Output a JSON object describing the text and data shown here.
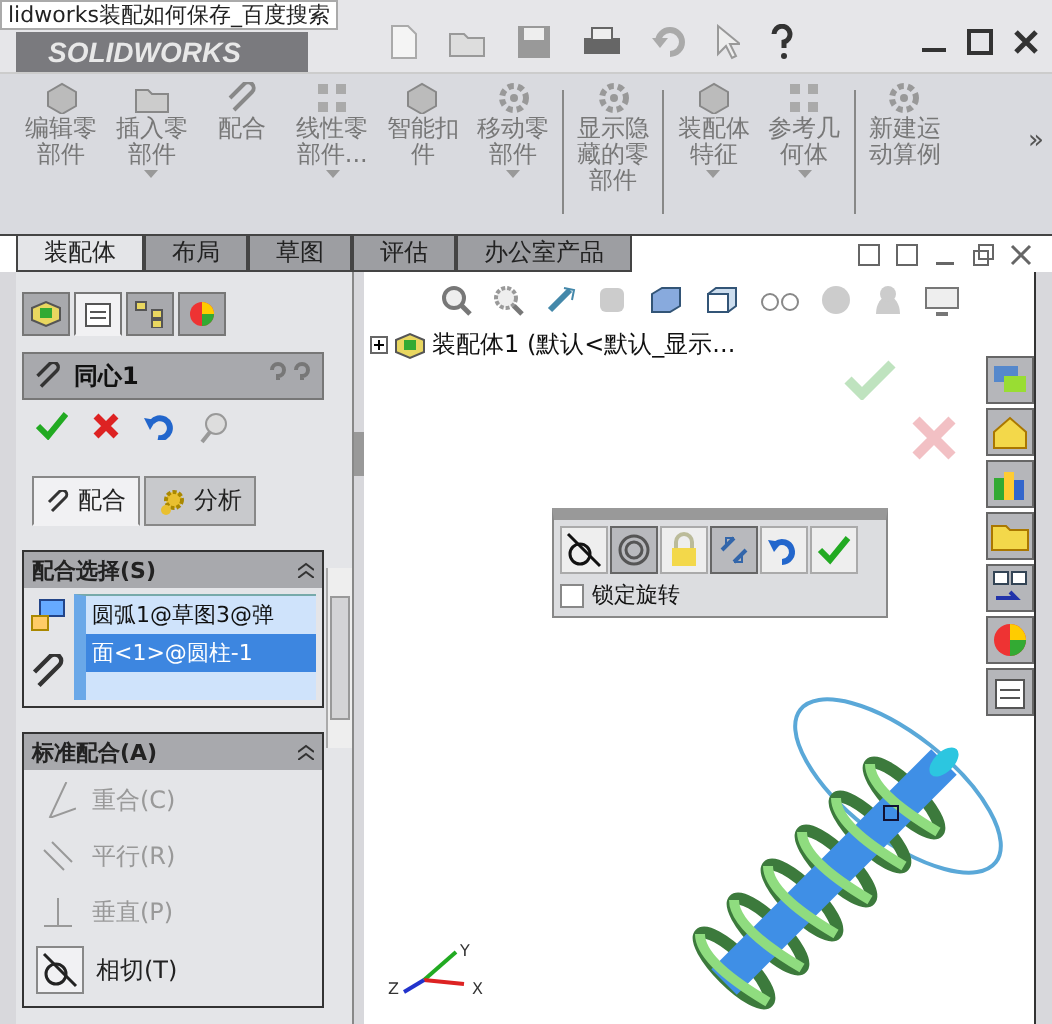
{
  "tooltip": "lidworks装配如何保存_百度搜索",
  "app_logo": "SOLIDWORKS",
  "ribbon": {
    "groups": [
      [
        {
          "label": "编辑零部件",
          "kind": "cube",
          "dropdown": false
        },
        {
          "label": "插入零部件",
          "kind": "folder",
          "dropdown": true
        },
        {
          "label": "配合",
          "kind": "paperclip",
          "dropdown": false
        },
        {
          "label": "线性零部件...",
          "kind": "grid",
          "dropdown": true
        },
        {
          "label": "智能扣件",
          "kind": "cube",
          "dropdown": false
        },
        {
          "label": "移动零部件",
          "kind": "gear",
          "dropdown": true
        }
      ],
      [
        {
          "label": "显示隐藏的零部件",
          "kind": "gear",
          "dropdown": false
        }
      ],
      [
        {
          "label": "装配体特征",
          "kind": "cube",
          "dropdown": true
        },
        {
          "label": "参考几何体",
          "kind": "grid",
          "dropdown": true
        }
      ],
      [
        {
          "label": "新建运动算例",
          "kind": "gear",
          "dropdown": false
        }
      ]
    ],
    "more": "»"
  },
  "tabs": [
    {
      "label": "装配体",
      "selected": true
    },
    {
      "label": "布局",
      "selected": false
    },
    {
      "label": "草图",
      "selected": false
    },
    {
      "label": "评估",
      "selected": false
    },
    {
      "label": "办公室产品",
      "selected": false
    }
  ],
  "panel_tabs": [
    {
      "kind": "feature",
      "selected": false
    },
    {
      "kind": "property",
      "selected": true
    },
    {
      "kind": "config",
      "selected": false
    },
    {
      "kind": "display",
      "selected": false
    }
  ],
  "property_title": "同心1",
  "subtabs": [
    {
      "label": "配合",
      "selected": true
    },
    {
      "label": "分析",
      "selected": false
    }
  ],
  "mate_selections": {
    "title": "配合选择(S)",
    "items": [
      {
        "text": "圆弧1@草图3@弹",
        "selected": false
      },
      {
        "text": "面<1>@圆柱-1",
        "selected": true
      }
    ]
  },
  "standard_mates": {
    "title": "标准配合(A)",
    "items": [
      {
        "label": "重合(C)",
        "kind": "coincident",
        "enabled": false
      },
      {
        "label": "平行(R)",
        "kind": "parallel",
        "enabled": false
      },
      {
        "label": "垂直(P)",
        "kind": "perpendicular",
        "enabled": false
      },
      {
        "label": "相切(T)",
        "kind": "tangent",
        "enabled": true
      }
    ]
  },
  "tree_root": {
    "label": "装配体1  (默认<默认_显示...",
    "expanded": false
  },
  "mate_popup": {
    "buttons": [
      {
        "kind": "tangent",
        "selected": false
      },
      {
        "kind": "concentric",
        "selected": true
      },
      {
        "kind": "lock",
        "selected": false
      },
      {
        "kind": "flip",
        "selected": true
      },
      {
        "kind": "undo",
        "selected": false
      },
      {
        "kind": "ok",
        "selected": false
      }
    ],
    "lock_rotation": {
      "label": "锁定旋转",
      "checked": false
    }
  },
  "triad": {
    "axes": [
      "Z",
      "Y",
      "X"
    ]
  }
}
